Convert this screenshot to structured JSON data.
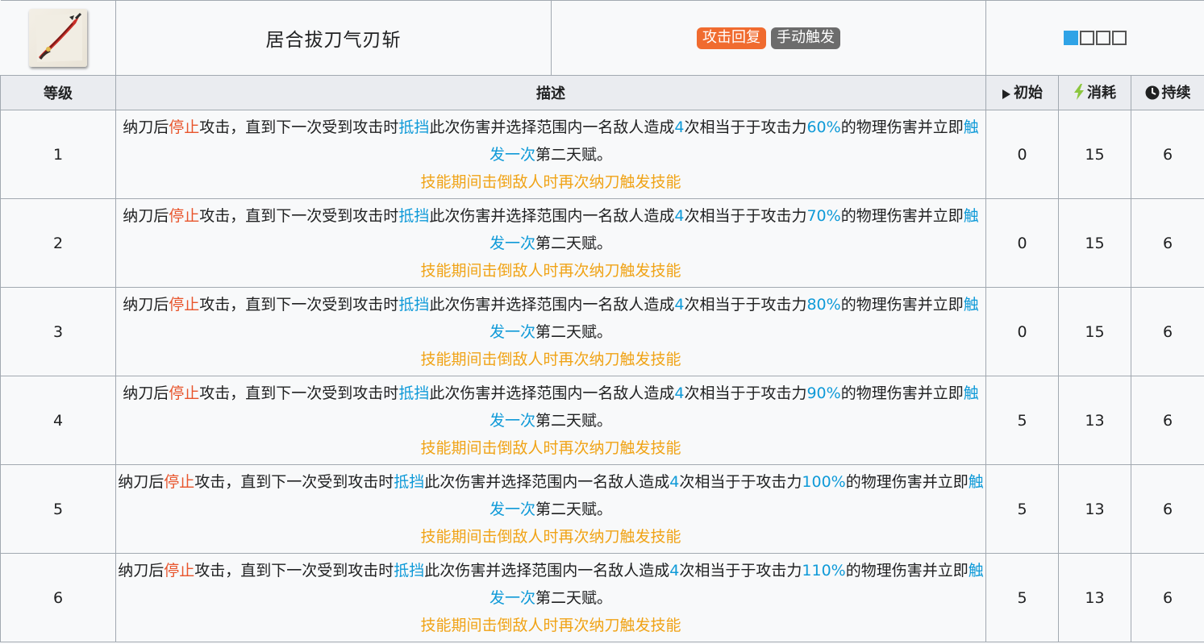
{
  "skill": {
    "name": "居合拔刀气刃斩",
    "tags": [
      "攻击回复",
      "手动触发"
    ],
    "icon": "blade-skill-icon",
    "sp_boxes_filled": 1,
    "sp_boxes_total": 4,
    "tag_colors": {
      "recover": "#f06b2f",
      "manual": "#6c6c6c"
    }
  },
  "headers": {
    "level": "等级",
    "description": "描述",
    "initial": "初始",
    "cost": "消耗",
    "duration": "持续"
  },
  "desc_parts": {
    "p1": "纳刀后",
    "stop": "停止",
    "p2": "攻击，直到下一次受到攻击时",
    "block": "抵挡",
    "p3": "此次伤害并选择范围内一名敌人造成",
    "hits": "4",
    "p4": "次相当于于攻击力",
    "p5": "的物理伤害并立即",
    "trigger": "触发一次",
    "p6": "第二天赋。",
    "note": "技能期间击倒敌人时再次纳刀触发技能"
  },
  "rows": [
    {
      "level": "1",
      "percent": "60%",
      "initial": "0",
      "cost": "15",
      "duration": "6"
    },
    {
      "level": "2",
      "percent": "70%",
      "initial": "0",
      "cost": "15",
      "duration": "6"
    },
    {
      "level": "3",
      "percent": "80%",
      "initial": "0",
      "cost": "15",
      "duration": "6"
    },
    {
      "level": "4",
      "percent": "90%",
      "initial": "5",
      "cost": "13",
      "duration": "6"
    },
    {
      "level": "5",
      "percent": "100%",
      "initial": "5",
      "cost": "13",
      "duration": "6"
    },
    {
      "level": "6",
      "percent": "110%",
      "initial": "5",
      "cost": "13",
      "duration": "6"
    }
  ],
  "colors": {
    "highlight_red": "#e8542b",
    "highlight_blue": "#0f9ad8",
    "note_orange": "#f0a316",
    "sp_filled": "#2fa3e6"
  }
}
